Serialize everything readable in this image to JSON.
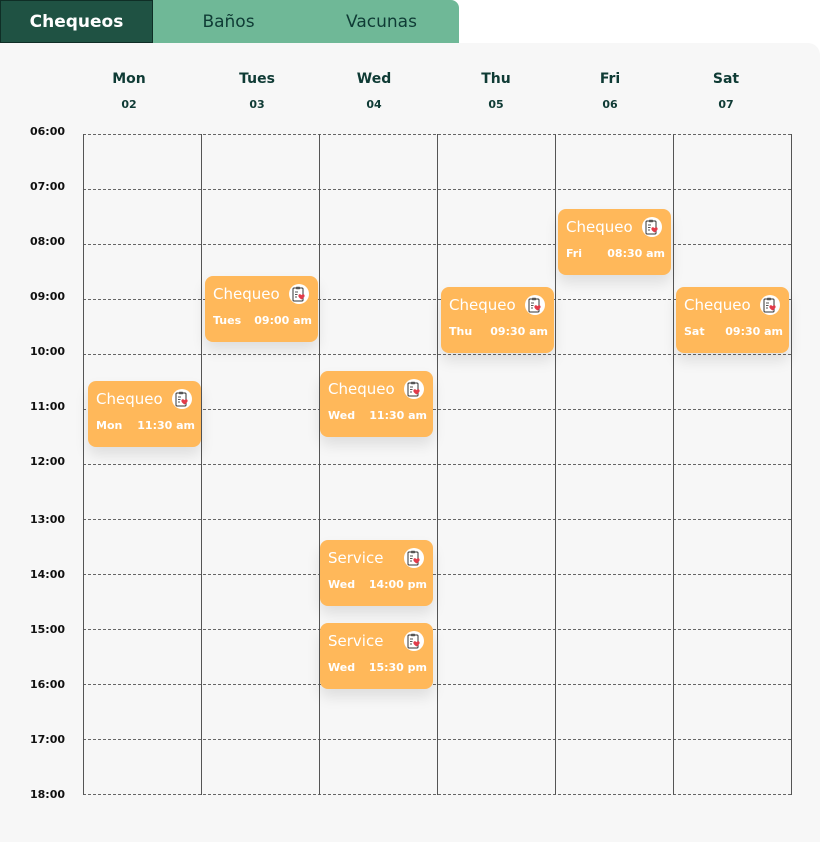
{
  "tabs": [
    {
      "label": "Chequeos",
      "active": true
    },
    {
      "label": "Baños",
      "active": false
    },
    {
      "label": "Vacunas",
      "active": false
    }
  ],
  "days": [
    {
      "name": "Mon",
      "date": "02"
    },
    {
      "name": "Tues",
      "date": "03"
    },
    {
      "name": "Wed",
      "date": "04"
    },
    {
      "name": "Thu",
      "date": "05"
    },
    {
      "name": "Fri",
      "date": "06"
    },
    {
      "name": "Sat",
      "date": "07"
    }
  ],
  "times": [
    "06:00",
    "07:00",
    "08:00",
    "09:00",
    "10:00",
    "11:00",
    "12:00",
    "13:00",
    "14:00",
    "15:00",
    "16:00",
    "17:00",
    "18:00"
  ],
  "events": [
    {
      "title": "Chequeo",
      "day": "Mon",
      "time": "11:30 am",
      "icon": "checkup-clipboard-heart-icon"
    },
    {
      "title": "Chequeo",
      "day": "Tues",
      "time": "09:00 am",
      "icon": "checkup-clipboard-heart-icon"
    },
    {
      "title": "Chequeo",
      "day": "Wed",
      "time": "11:30 am",
      "icon": "checkup-clipboard-heart-icon"
    },
    {
      "title": "Service",
      "day": "Wed",
      "time": "14:00 pm",
      "icon": "checkup-clipboard-heart-icon"
    },
    {
      "title": "Service",
      "day": "Wed",
      "time": "15:30 pm",
      "icon": "checkup-clipboard-heart-icon"
    },
    {
      "title": "Chequeo",
      "day": "Thu",
      "time": "09:30 am",
      "icon": "checkup-clipboard-heart-icon"
    },
    {
      "title": "Chequeo",
      "day": "Fri",
      "time": "08:30 am",
      "icon": "checkup-clipboard-heart-icon"
    },
    {
      "title": "Chequeo",
      "day": "Sat",
      "time": "09:30 am",
      "icon": "checkup-clipboard-heart-icon"
    }
  ],
  "colors": {
    "tab_active": "#1f5243",
    "tab_bar": "#6fb897",
    "event_bg": "#ffb85a",
    "text_dark": "#0f3b35",
    "panel_bg": "#f7f7f7"
  }
}
